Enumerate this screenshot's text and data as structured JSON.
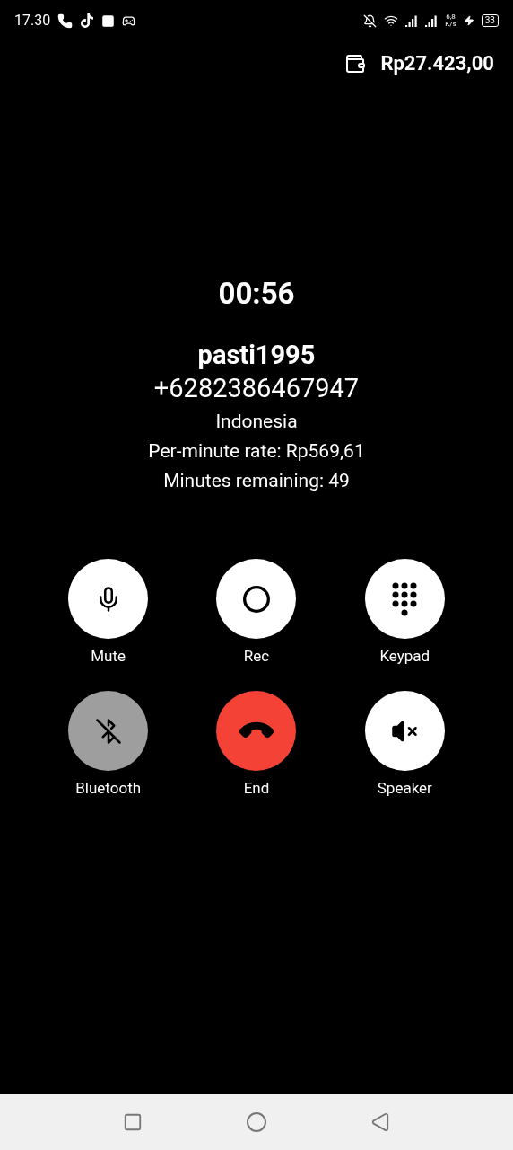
{
  "status_bar": {
    "time": "17.30",
    "speed_value": "6,8",
    "speed_unit": "K/s",
    "battery": "33"
  },
  "balance": "Rp27.423,00",
  "call": {
    "timer": "00:56",
    "name": "pasti1995",
    "number": "+6282386467947",
    "country": "Indonesia",
    "rate": "Per-minute rate: Rp569,61",
    "remaining": "Minutes remaining: 49"
  },
  "controls": [
    {
      "kind": "mute",
      "label": "Mute",
      "disabled": false
    },
    {
      "kind": "record",
      "label": "Rec",
      "disabled": false
    },
    {
      "kind": "keypad",
      "label": "Keypad",
      "disabled": false
    },
    {
      "kind": "bluetooth",
      "label": "Bluetooth",
      "disabled": true
    },
    {
      "kind": "end",
      "label": "End",
      "disabled": false
    },
    {
      "kind": "speaker",
      "label": "Speaker",
      "disabled": false
    }
  ]
}
